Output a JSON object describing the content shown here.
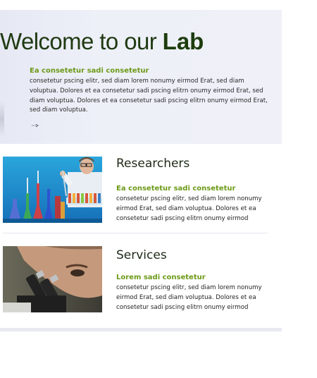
{
  "hero": {
    "title_light": "Welcome to our ",
    "title_bold": "Lab",
    "subtitle": "Ea consetetur sadi consetetur",
    "body": "consetetur pscing elitr, sed diam lorem nonumy eirmod Erat, sed diam voluptua. Dolores et ea consetetur sadi pscing elitrn onumy eirmod Erat, sed diam voluptua. Dolores et ea consetetur sadi pscing elitrn onumy eirmod Erat, sed diam voluptua.",
    "more_icon": "arrow-right-icon"
  },
  "sections": [
    {
      "title": "Researchers",
      "subtitle": "Ea consetetur sadi consetetur",
      "body": "consetetur pscing elitr, sed diam lorem nonumy eirmod Erat, sed diam voluptua. Dolores et ea consetetur sadi pscing elitrn onumy eirmod"
    },
    {
      "title": "Services",
      "subtitle": "Lorem sadi consetetur",
      "body": "consetetur pscing elitr, sed diam lorem nonumy eirmod Erat, sed diam voluptua. Dolores et ea consetetur sadi pscing elitrn onumy eirmod"
    }
  ],
  "colors": {
    "accent_green": "#6c9a17",
    "title_dark_green": "#1c3c0c",
    "hero_background": "#eef0f8"
  }
}
